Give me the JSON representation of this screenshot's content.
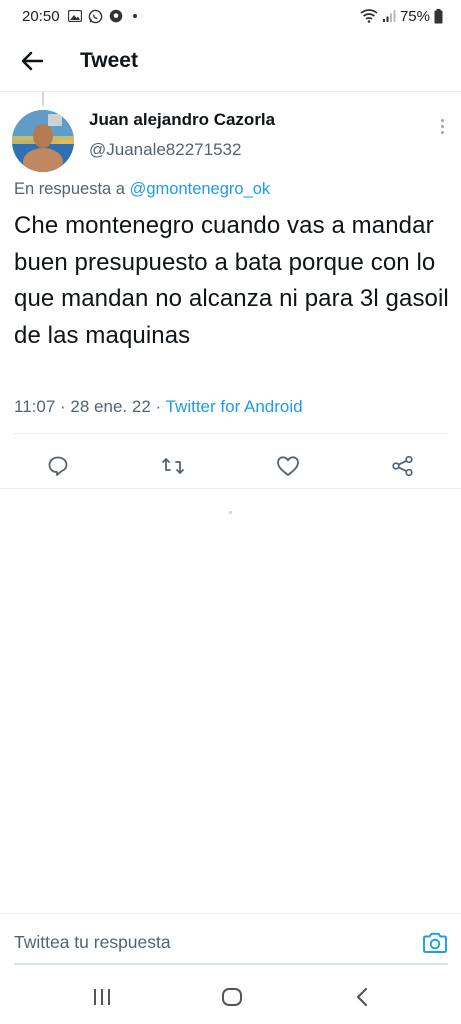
{
  "status_bar": {
    "time": "20:50",
    "battery": "75%",
    "icons": [
      "gallery-icon",
      "whatsapp-icon",
      "soccer-icon",
      "wifi-icon",
      "signal-icon",
      "battery-icon"
    ]
  },
  "header": {
    "back_icon": "arrow-left-icon",
    "title": "Tweet"
  },
  "tweet": {
    "author_name": "Juan alejandro Cazorla",
    "author_handle": "@Juanale82271532",
    "reply_prefix": "En respuesta a",
    "reply_mention": "@gmontenegro_ok",
    "text": "Che montenegro cuando vas a mandar buen presupuesto a bata porque con lo que mandan no alcanza ni para 3l gasoil de las maquinas",
    "time": "11:07",
    "separator": "·",
    "date": "28 ene. 22",
    "source": "Twitter for Android",
    "actions": [
      "reply-icon",
      "retweet-icon",
      "like-icon",
      "share-icon"
    ]
  },
  "composer": {
    "placeholder": "Twittea tu respuesta",
    "camera_icon": "camera-icon"
  },
  "nav": {
    "icons": [
      "recents-icon",
      "home-icon",
      "back-icon"
    ]
  },
  "colors": {
    "accent": "#1d9bf0",
    "text": "#0f1419",
    "secondary": "#536471",
    "divider": "#e6ecf0"
  }
}
